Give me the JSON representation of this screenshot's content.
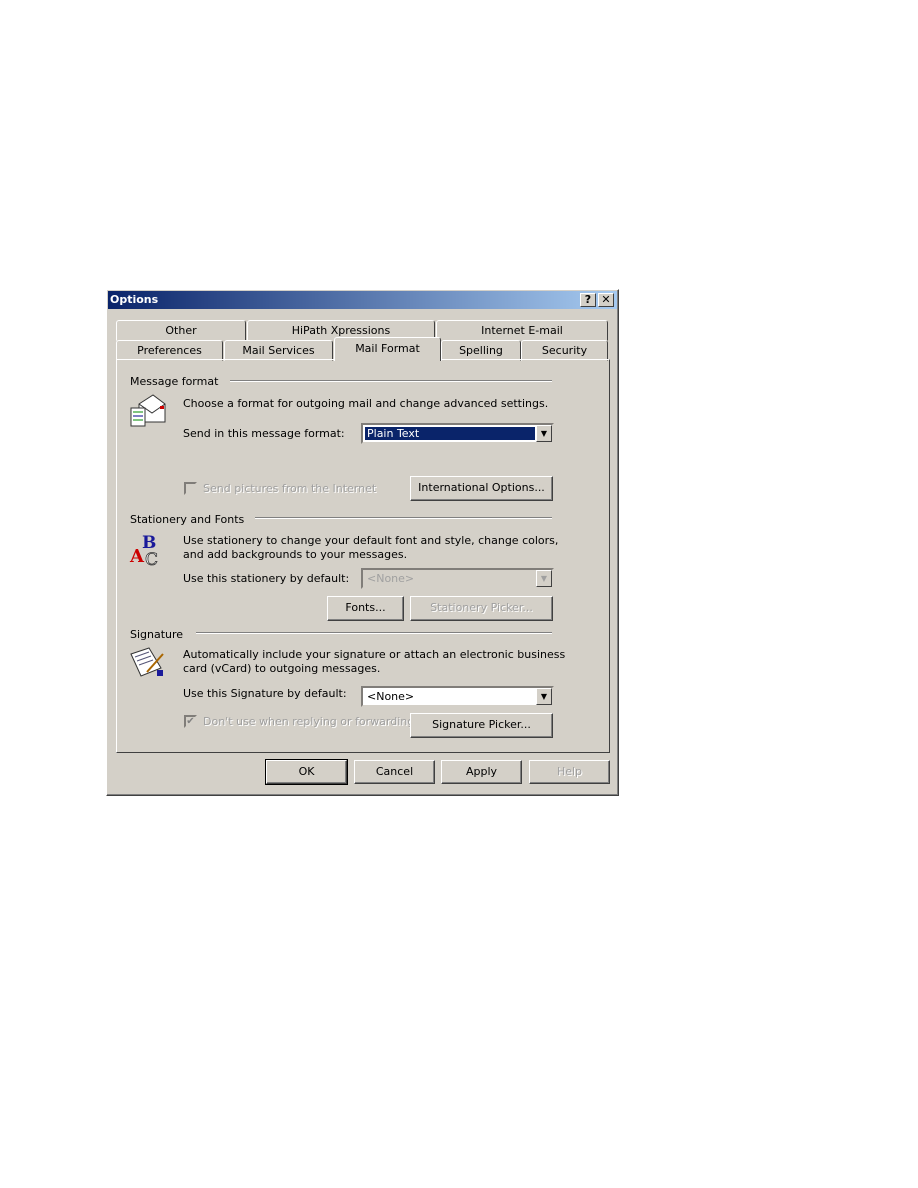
{
  "window": {
    "title": "Options",
    "help_label": "?",
    "close_label": "✕"
  },
  "tabs_row1": [
    {
      "label": "Other"
    },
    {
      "label": "HiPath Xpressions"
    },
    {
      "label": "Internet E-mail"
    }
  ],
  "tabs_row2": [
    {
      "label": "Preferences"
    },
    {
      "label": "Mail Services"
    },
    {
      "label": "Mail Format",
      "selected": true
    },
    {
      "label": "Spelling"
    },
    {
      "label": "Security"
    }
  ],
  "message_format": {
    "heading": "Message format",
    "description": "Choose a format for outgoing mail and change advanced settings.",
    "format_label": "Send in this message format:",
    "format_value": "Plain Text",
    "send_pictures_label": "Send pictures from the Internet",
    "send_pictures_checked": false,
    "international_button": "International Options...",
    "icon": "envelope-icon"
  },
  "stationery": {
    "heading": "Stationery and Fonts",
    "description_line1": "Use stationery to change your default font and style, change colors,",
    "description_line2": "and add backgrounds to your messages.",
    "default_label": "Use this stationery by default:",
    "default_value": "<None>",
    "fonts_button": "Fonts...",
    "picker_button": "Stationery Picker...",
    "icon": "abc-fonts-icon"
  },
  "signature": {
    "heading": "Signature",
    "description_line1": "Automatically include your signature or attach an electronic business",
    "description_line2": "card (vCard) to outgoing messages.",
    "default_label": "Use this Signature by default:",
    "default_value": "<None>",
    "dont_use_label": "Don't use when replying or forwarding",
    "dont_use_checked": true,
    "picker_button": "Signature Picker...",
    "icon": "signature-icon"
  },
  "footer": {
    "ok": "OK",
    "cancel": "Cancel",
    "apply": "Apply",
    "help": "Help"
  },
  "colors": {
    "titlebar_start": "#0a246a",
    "titlebar_end": "#a6caf0",
    "face": "#d4d0c8",
    "selection": "#0a246a"
  }
}
